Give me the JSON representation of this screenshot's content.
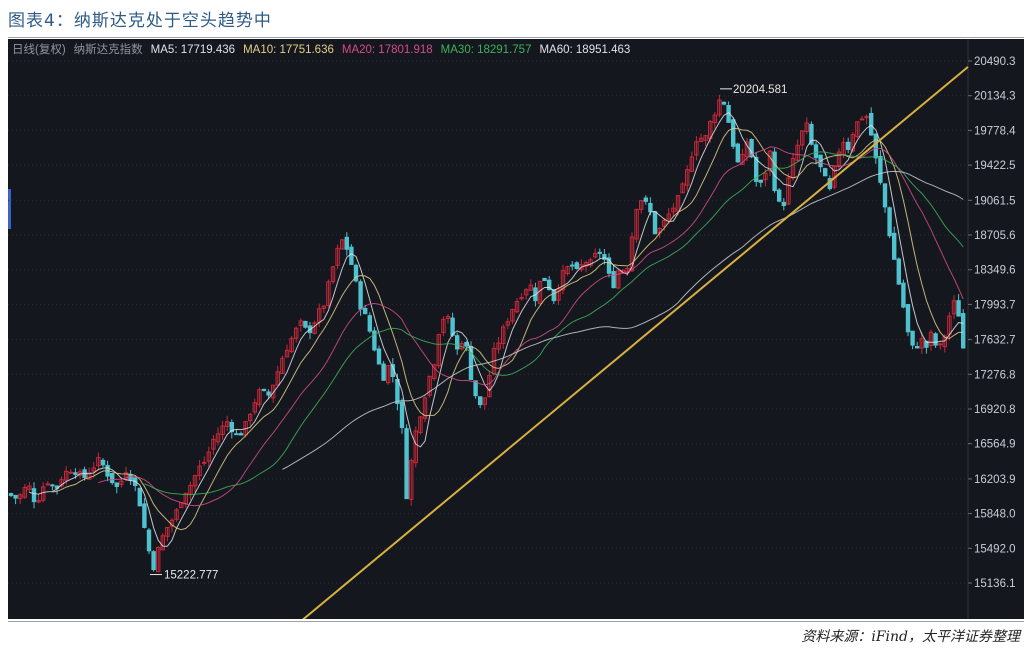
{
  "figure": {
    "title": "图表4：纳斯达克处于空头趋势中",
    "source": "资料来源：iFind，太平洋证券整理"
  },
  "legend": [
    {
      "label": "日线(复权)",
      "color": "#8f959d"
    },
    {
      "label": "纳斯达克指数",
      "color": "#8f959d"
    },
    {
      "label": "MA5: 17719.436",
      "color": "#dfe3e8"
    },
    {
      "label": "MA10: 17751.636",
      "color": "#e0cf88"
    },
    {
      "label": "MA20: 17801.918",
      "color": "#d44d86"
    },
    {
      "label": "MA30: 18291.757",
      "color": "#3fb05a"
    },
    {
      "label": "MA60: 18951.463",
      "color": "#dfe3e8"
    }
  ],
  "chart_data": {
    "type": "candlestick",
    "title": "",
    "y_ticks": [
      "20490.3",
      "20134.3",
      "19778.4",
      "19422.5",
      "19061.5",
      "18705.6",
      "18349.6",
      "17993.7",
      "17632.7",
      "17276.8",
      "16920.8",
      "16564.9",
      "16203.9",
      "15848.0",
      "15492.0",
      "15136.1"
    ],
    "ylim": [
      15000,
      20560
    ],
    "annotations": [
      {
        "text": "20204.581",
        "value": 20204.581,
        "type": "max"
      },
      {
        "text": "15222.777",
        "value": 15222.777,
        "type": "min"
      }
    ],
    "trendline": {
      "from": 14600,
      "to": 20430,
      "color": "#d8b040"
    },
    "colors": {
      "up": "#c8283a",
      "down": "#4fc2cf",
      "background": "#14171d",
      "grid": "#2a2f38"
    },
    "close_path": [
      [
        0,
        16050
      ],
      [
        10,
        16000
      ],
      [
        20,
        16150
      ],
      [
        28,
        15950
      ],
      [
        38,
        16200
      ],
      [
        48,
        16100
      ],
      [
        55,
        16250
      ],
      [
        65,
        16320
      ],
      [
        75,
        16200
      ],
      [
        82,
        16300
      ],
      [
        92,
        16400
      ],
      [
        100,
        16250
      ],
      [
        110,
        16100
      ],
      [
        118,
        16300
      ],
      [
        125,
        16200
      ],
      [
        132,
        15950
      ],
      [
        140,
        15500
      ],
      [
        146,
        15300
      ],
      [
        152,
        15550
      ],
      [
        160,
        15720
      ],
      [
        168,
        15850
      ],
      [
        175,
        16050
      ],
      [
        183,
        16150
      ],
      [
        190,
        16300
      ],
      [
        198,
        16400
      ],
      [
        205,
        16600
      ],
      [
        212,
        16700
      ],
      [
        220,
        16800
      ],
      [
        228,
        16650
      ],
      [
        236,
        16700
      ],
      [
        244,
        16950
      ],
      [
        252,
        17100
      ],
      [
        260,
        17050
      ],
      [
        268,
        17250
      ],
      [
        276,
        17500
      ],
      [
        284,
        17650
      ],
      [
        292,
        17800
      ],
      [
        300,
        17700
      ],
      [
        308,
        17850
      ],
      [
        316,
        18000
      ],
      [
        322,
        18250
      ],
      [
        328,
        18500
      ],
      [
        334,
        18650
      ],
      [
        340,
        18550
      ],
      [
        346,
        18300
      ],
      [
        352,
        18000
      ],
      [
        358,
        17850
      ],
      [
        364,
        17650
      ],
      [
        370,
        17400
      ],
      [
        376,
        17250
      ],
      [
        382,
        17400
      ],
      [
        388,
        17100
      ],
      [
        394,
        16700
      ],
      [
        398,
        16000
      ],
      [
        402,
        16300
      ],
      [
        408,
        16700
      ],
      [
        414,
        16950
      ],
      [
        420,
        17200
      ],
      [
        426,
        17400
      ],
      [
        432,
        17800
      ],
      [
        438,
        17900
      ],
      [
        444,
        17700
      ],
      [
        450,
        17500
      ],
      [
        456,
        17700
      ],
      [
        462,
        17300
      ],
      [
        468,
        17050
      ],
      [
        474,
        16900
      ],
      [
        480,
        17200
      ],
      [
        486,
        17500
      ],
      [
        492,
        17650
      ],
      [
        498,
        17800
      ],
      [
        504,
        17950
      ],
      [
        510,
        18050
      ],
      [
        516,
        18150
      ],
      [
        522,
        18200
      ],
      [
        528,
        18050
      ],
      [
        534,
        18300
      ],
      [
        540,
        18200
      ],
      [
        546,
        18050
      ],
      [
        552,
        18250
      ],
      [
        558,
        18350
      ],
      [
        564,
        18400
      ],
      [
        570,
        18300
      ],
      [
        576,
        18450
      ],
      [
        582,
        18400
      ],
      [
        588,
        18500
      ],
      [
        594,
        18550
      ],
      [
        600,
        18300
      ],
      [
        606,
        18200
      ],
      [
        612,
        18400
      ],
      [
        618,
        18300
      ],
      [
        624,
        18700
      ],
      [
        630,
        19100
      ],
      [
        636,
        19050
      ],
      [
        642,
        18950
      ],
      [
        648,
        18700
      ],
      [
        654,
        18800
      ],
      [
        660,
        18900
      ],
      [
        666,
        19000
      ],
      [
        672,
        19100
      ],
      [
        678,
        19300
      ],
      [
        684,
        19550
      ],
      [
        690,
        19750
      ],
      [
        696,
        19650
      ],
      [
        702,
        19850
      ],
      [
        708,
        20000
      ],
      [
        714,
        20150
      ],
      [
        720,
        19900
      ],
      [
        726,
        19600
      ],
      [
        732,
        19350
      ],
      [
        738,
        19700
      ],
      [
        744,
        19500
      ],
      [
        750,
        19150
      ],
      [
        756,
        19300
      ],
      [
        762,
        19550
      ],
      [
        768,
        19100
      ],
      [
        774,
        18950
      ],
      [
        780,
        19250
      ],
      [
        786,
        19500
      ],
      [
        792,
        19700
      ],
      [
        798,
        19850
      ],
      [
        804,
        19600
      ],
      [
        810,
        19450
      ],
      [
        816,
        19300
      ],
      [
        822,
        19150
      ],
      [
        828,
        19450
      ],
      [
        834,
        19700
      ],
      [
        840,
        19600
      ],
      [
        846,
        19800
      ],
      [
        852,
        19900
      ],
      [
        858,
        19950
      ],
      [
        864,
        19700
      ],
      [
        870,
        19350
      ],
      [
        876,
        19050
      ],
      [
        882,
        18700
      ],
      [
        888,
        18350
      ],
      [
        894,
        18050
      ],
      [
        900,
        17700
      ],
      [
        906,
        17500
      ],
      [
        912,
        17650
      ],
      [
        918,
        17550
      ],
      [
        924,
        17700
      ],
      [
        930,
        17500
      ],
      [
        936,
        17650
      ],
      [
        942,
        17900
      ],
      [
        948,
        18050
      ],
      [
        954,
        17700
      ],
      [
        958,
        17200
      ],
      [
        960,
        17000
      ]
    ]
  }
}
